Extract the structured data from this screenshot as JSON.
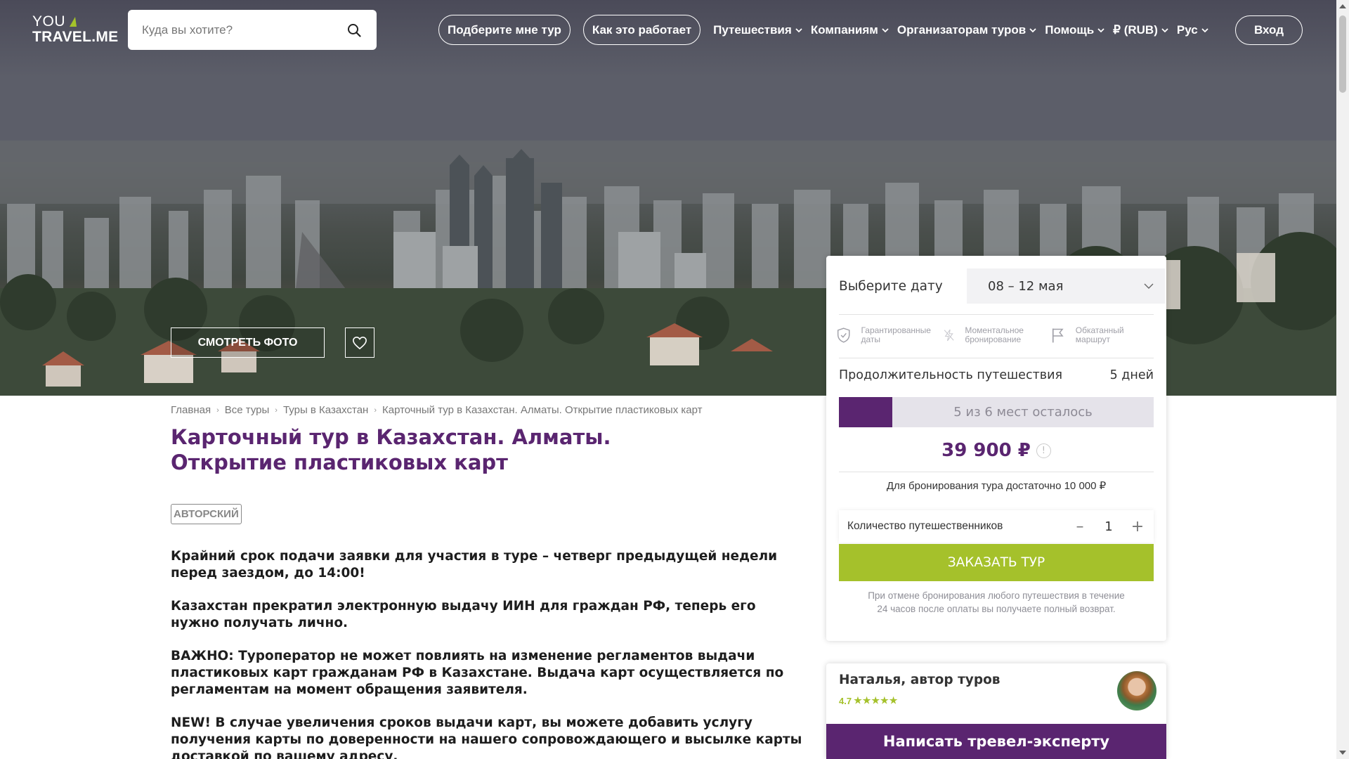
{
  "logo": {
    "line1": "YOU",
    "line2": "TRAVEL.ME"
  },
  "search": {
    "placeholder": "Куда вы хотите?"
  },
  "nav": {
    "pick_tour": "Подберите мне тур",
    "how_it_works": "Как это работает",
    "travel": "Путешествия",
    "companies": "Компаниям",
    "organizers": "Организаторам туров",
    "help": "Помощь",
    "currency": "₽ (RUB)",
    "language": "Рус",
    "login": "Вход"
  },
  "hero": {
    "photo_button": "СМОТРЕТЬ ФОТО"
  },
  "breadcrumbs": [
    "Главная",
    "Все туры",
    "Туры в Казахстан",
    "Карточный тур в Казахстан. Алматы. Открытие пластиковых карт"
  ],
  "tour": {
    "title": "Карточный тур в Казахстан. Алматы. Открытие пластиковых карт",
    "badge": "АВТОРСКИЙ",
    "paragraphs": [
      "Крайний срок подачи заявки для участия в туре – четверг предыдущей недели перед заездом, до 14:00!",
      "Казахстан прекратил электронную выдачу ИИН для граждан РФ, теперь его нужно получать лично.",
      "ВАЖНО: Туроператор не может повлиять на изменение регламентов выдачи пластиковых карт гражданам РФ в Казахстане. Выдача карт осуществляется по регламентам на момент обращения заявителя.",
      "NEW! В случае увеличения сроков выдачи карт, вы можете добавить услугу получения карты по доверенности на нашего сопровождающего и высылке карты доставкой по вашему адресу."
    ]
  },
  "booking": {
    "date_label": "Выберите дату",
    "date_value": "08 – 12 мая",
    "features": [
      {
        "icon": "shield-check-icon",
        "label": "Гарантированные даты"
      },
      {
        "icon": "lightning-icon",
        "label": "Моментальное бронирование"
      },
      {
        "icon": "flag-icon",
        "label": "Обкатанный маршрут"
      }
    ],
    "duration_label": "Продолжительность путешествия",
    "duration_value": "5 дней",
    "seats_text": "5 из 6 мест осталось",
    "seats_taken_fraction": 0.17,
    "price": "39 900 ₽",
    "prepay_text": "Для бронирования тура достаточно 10 000 ₽",
    "travelers_label": "Количество путешественников",
    "travelers_count": "1",
    "order_button": "ЗАКАЗАТЬ ТУР",
    "refund_text": "При отмене бронирования любого путешествия в течение 24 часов после оплаты вы получаете полный возврат."
  },
  "author": {
    "name": "Наталья, автор туров",
    "rating": "4.7",
    "stars": "★★★★★",
    "write_button": "Написать тревел-эксперту"
  },
  "colors": {
    "brand_purple": "#5a2570",
    "accent_green": "#a5c12b"
  }
}
